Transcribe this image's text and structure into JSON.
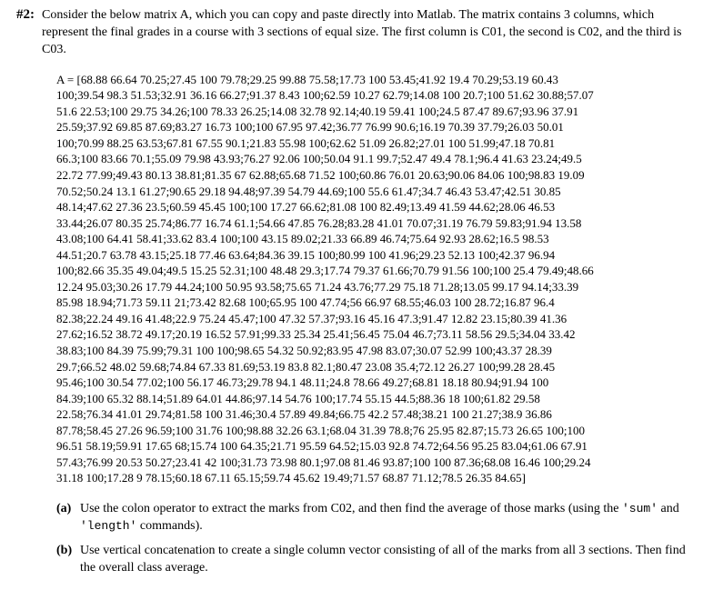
{
  "problem": {
    "number": "#2:",
    "intro": "Consider the below matrix A, which you can copy and paste directly into Matlab. The matrix contains 3 columns, which represent the final grades in a course with 3 sections of equal size. The first column is C01, the second is C02, and the third is C03."
  },
  "matrix": {
    "lines": [
      "A = [68.88 66.64 70.25;27.45 100 79.78;29.25 99.88 75.58;17.73 100 53.45;41.92 19.4 70.29;53.19 60.43",
      "100;39.54 98.3 51.53;32.91 36.16 66.27;91.37 8.43 100;62.59 10.27 62.79;14.08 100 20.7;100 51.62 30.88;57.07",
      "51.6 22.53;100 29.75 34.26;100 78.33 26.25;14.08 32.78 92.14;40.19 59.41 100;24.5 87.47 89.67;93.96 37.91",
      "25.59;37.92 69.85 87.69;83.27 16.73 100;100 67.95 97.42;36.77 76.99 90.6;16.19 70.39 37.79;26.03 50.01",
      "100;70.99 88.25 63.53;67.81 67.55 90.1;21.83 55.98 100;62.62 51.09 26.82;27.01 100 51.99;47.18 70.81",
      "66.3;100 83.66 70.1;55.09 79.98 43.93;76.27 92.06 100;50.04 91.1 99.7;52.47 49.4 78.1;96.4 41.63 23.24;49.5",
      "22.72 77.99;49.43 80.13 38.81;81.35 67 62.88;65.68 71.52 100;60.86 76.01 20.63;90.06 84.06 100;98.83 19.09",
      "70.52;50.24 13.1 61.27;90.65 29.18 94.48;97.39 54.79 44.69;100 55.6 61.47;34.7 46.43 53.47;42.51 30.85",
      "48.14;47.62 27.36 23.5;60.59 45.45 100;100 17.27 66.62;81.08 100 82.49;13.49 41.59 44.62;28.06 46.53",
      "33.44;26.07 80.35 25.74;86.77 16.74 61.1;54.66 47.85 76.28;83.28 41.01 70.07;31.19 76.79 59.83;91.94 13.58",
      "43.08;100 64.41 58.41;33.62 83.4 100;100 43.15 89.02;21.33 66.89 46.74;75.64 92.93 28.62;16.5 98.53",
      "44.51;20.7 63.78 43.15;25.18 77.46 63.64;84.36 39.15 100;80.99 100 41.96;29.23 52.13 100;42.37 96.94",
      "100;82.66 35.35 49.04;49.5 15.25 52.31;100 48.48 29.3;17.74 79.37 61.66;70.79 91.56 100;100 25.4 79.49;48.66",
      "12.24 95.03;30.26 17.79 44.24;100 50.95 93.58;75.65 71.24 43.76;77.29 75.18 71.28;13.05 99.17 94.14;33.39",
      "85.98 18.94;71.73 59.11 21;73.42 82.68 100;65.95 100 47.74;56 66.97 68.55;46.03 100 28.72;16.87 96.4",
      "82.38;22.24 49.16 41.48;22.9 75.24 45.47;100 47.32 57.37;93.16 45.16 47.3;91.47 12.82 23.15;80.39 41.36",
      "27.62;16.52 38.72 49.17;20.19 16.52 57.91;99.33 25.34 25.41;56.45 75.04 46.7;73.11 58.56 29.5;34.04 33.42",
      "38.83;100 84.39 75.99;79.31 100 100;98.65 54.32 50.92;83.95 47.98 83.07;30.07 52.99 100;43.37 28.39",
      "29.7;66.52 48.02 59.68;74.84 67.33 81.69;53.19 83.8 82.1;80.47 23.08 35.4;72.12 26.27 100;99.28 28.45",
      "95.46;100 30.54 77.02;100 56.17 46.73;29.78 94.1 48.11;24.8 78.66 49.27;68.81 18.18 80.94;91.94 100",
      "84.39;100 65.32 88.14;51.89 64.01 44.86;97.14 54.76 100;17.74 55.15 44.5;88.36 18 100;61.82 29.58",
      "22.58;76.34 41.01 29.74;81.58 100 31.46;30.4 57.89 49.84;66.75 42.2 57.48;38.21 100 21.27;38.9 36.86",
      "87.78;58.45 27.26 96.59;100 31.76 100;98.88 32.26 63.1;68.04 31.39 78.8;76 25.95 82.87;15.73 26.65 100;100",
      "96.51 58.19;59.91 17.65 68;15.74 100 64.35;21.71 95.59 64.52;15.03 92.8 74.72;64.56 95.25 83.04;61.06 67.91",
      "57.43;76.99 20.53 50.27;23.41 42 100;31.73 73.98 80.1;97.08 81.46 93.87;100 100 87.36;68.08 16.46 100;29.24",
      "31.18 100;17.28 9 78.15;60.18 67.11 65.15;59.74 45.62 19.49;71.57 68.87 71.12;78.5 26.35 84.65]"
    ]
  },
  "parts": {
    "a": {
      "label": "(a)",
      "text_pre": "Use the colon operator to extract the marks from C02, and then find the average of those marks (using the ",
      "code1": "'sum'",
      "mid": " and ",
      "code2": "'length'",
      "text_post": " commands)."
    },
    "b": {
      "label": "(b)",
      "text": "Use vertical concatenation to create a single column vector consisting of all of the marks from all 3 sections. Then find the overall class average."
    }
  }
}
